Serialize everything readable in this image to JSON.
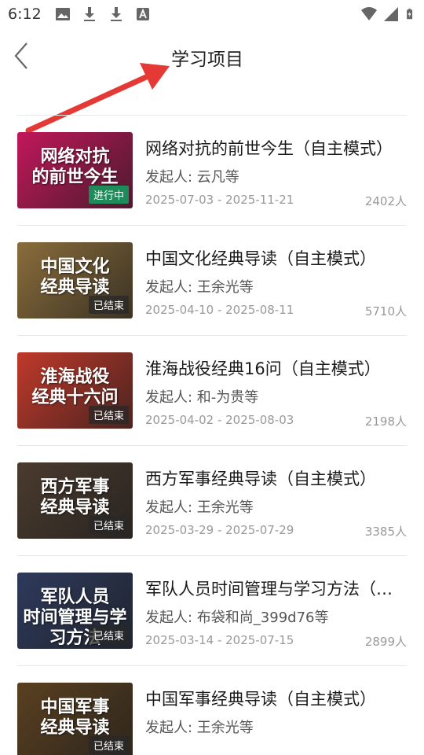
{
  "status_bar": {
    "time": "6:12",
    "left_icons": [
      "image-icon",
      "download-icon",
      "download-icon",
      "font-icon"
    ],
    "right_icons": [
      "wifi-icon",
      "signal-icon",
      "battery-charging-icon"
    ]
  },
  "header": {
    "title": "学习项目",
    "back_icon": "chevron-left-icon"
  },
  "annotation": {
    "arrow_color": "#e53935"
  },
  "items": [
    {
      "thumb_title": "网络对抗\n的前世今生",
      "thumb_color": "#c2185b",
      "tag": "进行中",
      "tag_state": "active",
      "title": "网络对抗的前世今生（自主模式）",
      "initiator": "发起人: 云凡等",
      "dates": "2025-07-03 - 2025-11-21",
      "count": "2402人"
    },
    {
      "thumb_title": "中国文化\n经典导读",
      "thumb_color": "#8a6d3b",
      "tag": "已结束",
      "tag_state": "ended",
      "title": "中国文化经典导读（自主模式）",
      "initiator": "发起人: 王余光等",
      "dates": "2025-04-10 - 2025-08-11",
      "count": "5710人"
    },
    {
      "thumb_title": "淮海战役\n经典十六问",
      "thumb_color": "#c0392b",
      "tag": "已结束",
      "tag_state": "ended",
      "title": "淮海战役经典16问（自主模式）",
      "initiator": "发起人: 和-为贵等",
      "dates": "2025-04-02 - 2025-08-03",
      "count": "2198人"
    },
    {
      "thumb_title": "西方军事\n经典导读",
      "thumb_color": "#4a3b2e",
      "tag": "已结束",
      "tag_state": "ended",
      "title": "西方军事经典导读（自主模式）",
      "initiator": "发起人: 王余光等",
      "dates": "2025-03-29 - 2025-07-29",
      "count": "3385人"
    },
    {
      "thumb_title": "军队人员\n时间管理与学习方法",
      "thumb_color": "#2e3a5c",
      "tag": "已结束",
      "tag_state": "ended",
      "title": "军队人员时间管理与学习方法（自主模式）",
      "initiator": "发起人: 布袋和尚_399d76等",
      "dates": "2025-03-14 - 2025-07-15",
      "count": "2899人"
    },
    {
      "thumb_title": "中国军事\n经典导读",
      "thumb_color": "#5a4020",
      "tag": "已结束",
      "tag_state": "ended",
      "title": "中国军事经典导读（自主模式）",
      "initiator": "发起人: 王余光等",
      "dates": "",
      "count": ""
    }
  ]
}
